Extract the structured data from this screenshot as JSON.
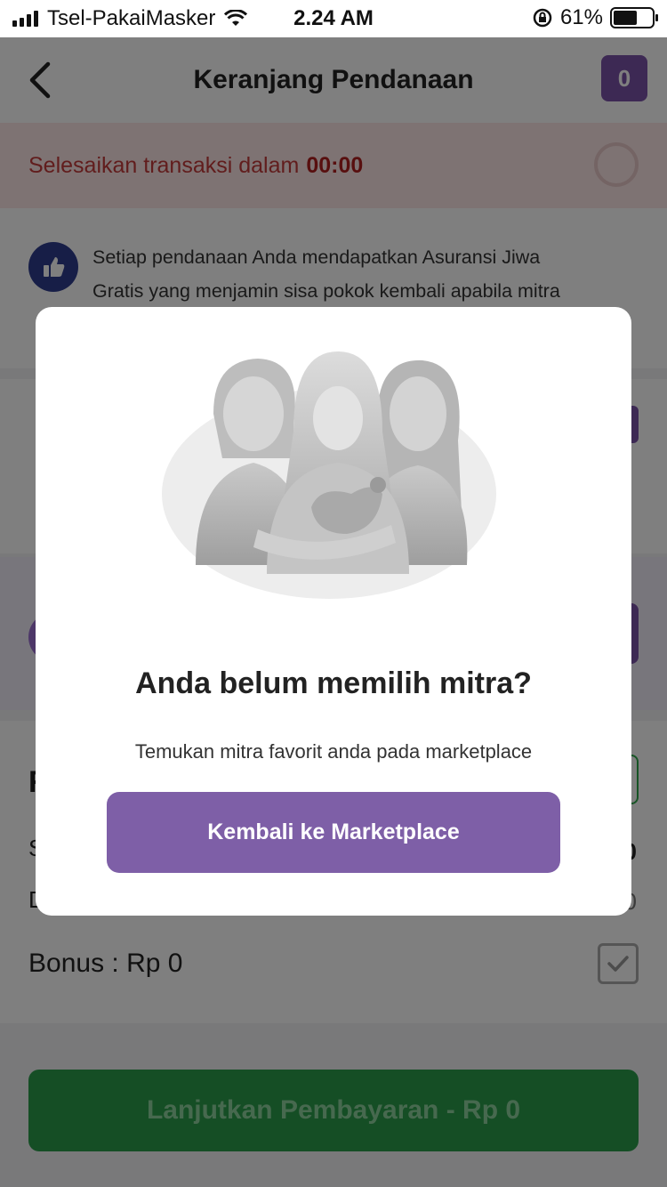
{
  "status_bar": {
    "carrier": "Tsel-PakaiMasker",
    "time": "2.24 AM",
    "battery": "61%",
    "battery_level": 0.61
  },
  "nav": {
    "title": "Keranjang Pendanaan",
    "cart_count": "0"
  },
  "timer": {
    "label": "Selesaikan transaksi dalam",
    "value": "00:00"
  },
  "info": {
    "text_line1": "Setiap pendanaan Anda mendapatkan Asuransi Jiwa",
    "text_line2": "Gratis yang menjamin sisa pokok kembali apabila mitra"
  },
  "summary": {
    "heading_partial": "R",
    "row1_partial": "S",
    "row2_partial": "D",
    "row1_value_partial": "0",
    "row2_value_partial": "0",
    "bonus": "Bonus : Rp 0"
  },
  "pay_button": "Lanjutkan Pembayaran - Rp 0",
  "modal": {
    "title": "Anda belum memilih mitra?",
    "subtitle": "Temukan mitra favorit anda pada marketplace",
    "button": "Kembali ke Marketplace"
  }
}
